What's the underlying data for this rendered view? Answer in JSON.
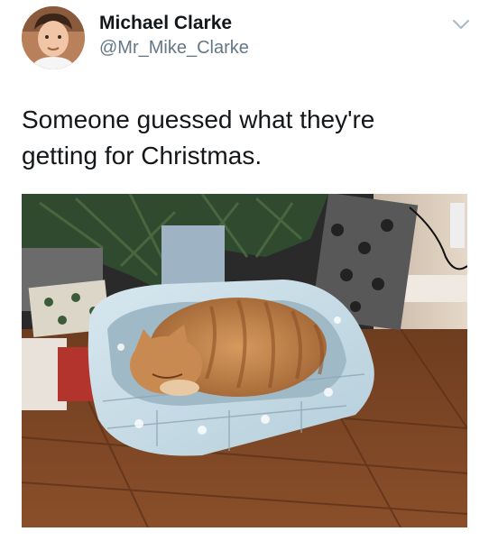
{
  "user": {
    "display_name": "Michael Clarke",
    "handle": "@Mr_Mike_Clarke",
    "avatar_icon": "profile-photo"
  },
  "tweet": {
    "text_line1": "Someone guessed what they're",
    "text_line2": "getting for Christmas."
  },
  "menu_icon": "chevron-down-icon",
  "colors": {
    "handle": "#657786",
    "chevron": "#aab8c2",
    "text": "#14171a"
  }
}
